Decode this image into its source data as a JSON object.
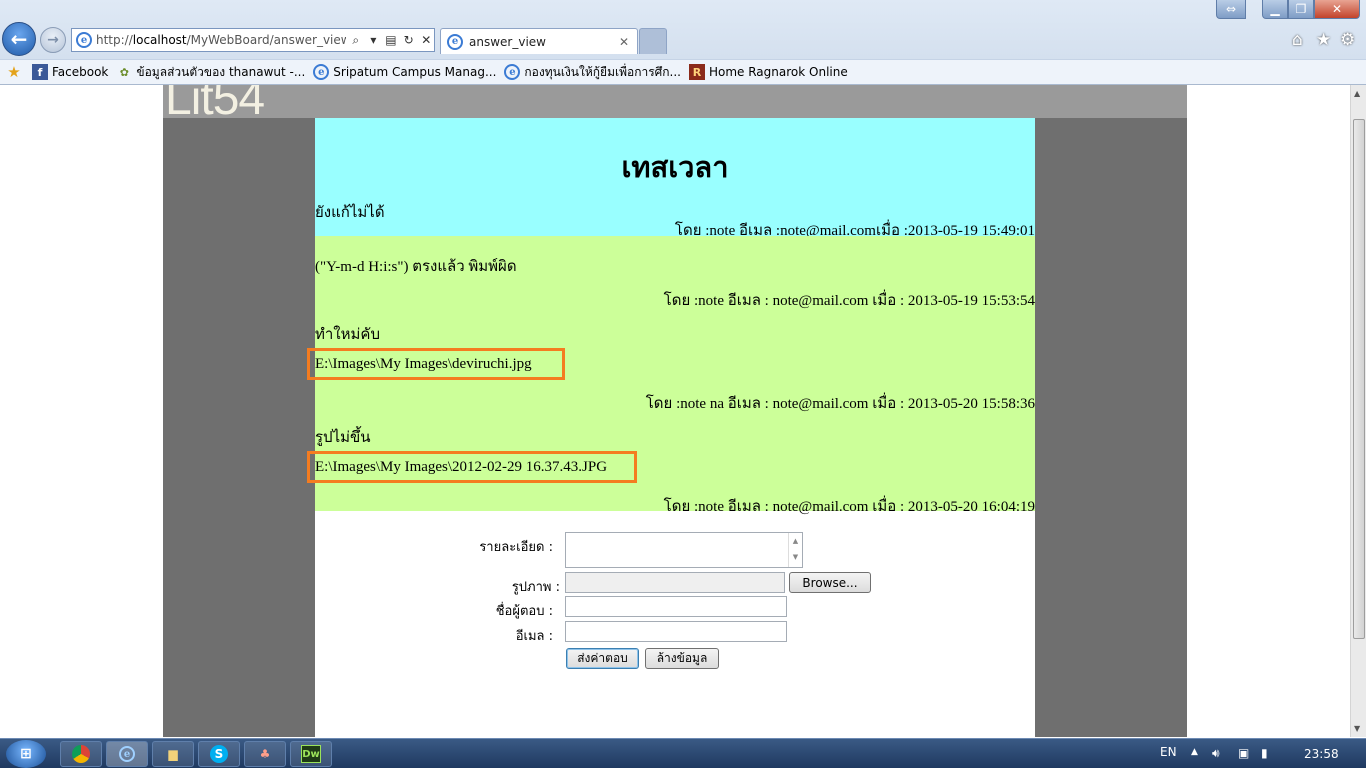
{
  "browser": {
    "url_prefix": "http://",
    "url_host": "localhost",
    "url_path": "/MyWebBoard/answer_view.php",
    "tab_title": "answer_view"
  },
  "favorites": [
    {
      "label": "Facebook",
      "icon": "facebook-icon"
    },
    {
      "label": "ข้อมูลส่วนตัวของ thanawut -...",
      "icon": "profile-icon"
    },
    {
      "label": "Sripatum Campus Manag...",
      "icon": "ie-icon"
    },
    {
      "label": "กองทุนเงินให้กู้ยืมเพื่อการศึก...",
      "icon": "ie-icon"
    },
    {
      "label": "Home  Ragnarok Online",
      "icon": "ragnarok-icon"
    }
  ],
  "page": {
    "logo_text": "Lit54",
    "question": {
      "title": "เทสเวลา",
      "detail": "ยังแก้ไม่ได้",
      "meta": "โดย :note อีเมล :note@mail.comเมื่อ :2013-05-19 15:49:01"
    },
    "answers": [
      {
        "detail": "(\"Y-m-d H:i:s\") ตรงแล้ว พิมพ์ผิด",
        "image": "",
        "meta": "โดย :note อีเมล : note@mail.com เมื่อ : 2013-05-19 15:53:54"
      },
      {
        "detail": "ทำใหม่คับ",
        "image": "E:\\Images\\My Images\\deviruchi.jpg",
        "meta": "โดย :note na อีเมล : note@mail.com เมื่อ : 2013-05-20 15:58:36"
      },
      {
        "detail": "รูปไม่ขึ้น",
        "image": "E:\\Images\\My Images\\2012-02-29 16.37.43.JPG",
        "meta": "โดย :note อีเมล : note@mail.com เมื่อ : 2013-05-20 16:04:19"
      }
    ],
    "form": {
      "detail_label": "รายละเอียด :",
      "image_label": "รูปภาพ :",
      "browse_label": "Browse...",
      "name_label": "ชื่อผู้ตอบ :",
      "email_label": "อีเมล :",
      "submit_label": "ส่งค่าตอบ",
      "reset_label": "ล้างข้อมูล"
    }
  },
  "taskbar": {
    "language": "EN",
    "time": "23:58"
  },
  "colors": {
    "question_bg": "#99ffff",
    "answers_bg": "#ccff99",
    "highlight": "#f47c20",
    "page_bg": "#6f6f6f"
  }
}
